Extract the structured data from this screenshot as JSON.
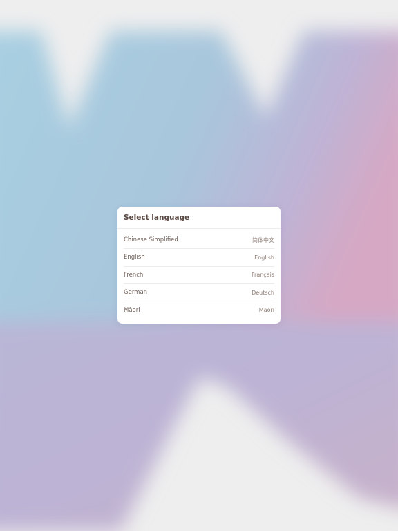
{
  "dialog": {
    "title": "Select language",
    "languages": [
      {
        "name": "Chinese Simplified",
        "native": "简体中文"
      },
      {
        "name": "English",
        "native": "English"
      },
      {
        "name": "French",
        "native": "Français"
      },
      {
        "name": "German",
        "native": "Deutsch"
      },
      {
        "name": "Māori",
        "native": "Māori"
      }
    ]
  },
  "background": {
    "colors": [
      "#a9cfe0",
      "#b6bcda",
      "#d1afc7",
      "#bcb2d2",
      "#eeeeee"
    ]
  }
}
